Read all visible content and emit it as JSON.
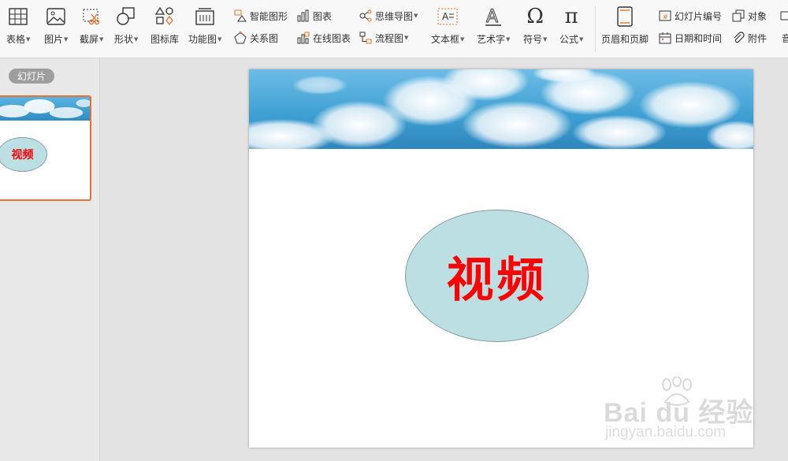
{
  "ribbon": {
    "table": "表格",
    "picture": "图片",
    "screenshot": "截屏",
    "shape": "形状",
    "icon_library": "图标库",
    "function_chart": "功能图",
    "smart_art": "智能图形",
    "relation": "关系图",
    "chart": "图表",
    "online_chart": "在线图表",
    "mind_map": "思维导图",
    "flow_chart": "流程图",
    "text_box": "文本框",
    "word_art": "艺术字",
    "symbol": "符号",
    "formula": "公式",
    "header_footer": "页眉和页脚",
    "slide_number": "幻灯片编号",
    "date_time": "日期和时间",
    "object": "对象",
    "attachment": "附件",
    "audio_cut": "音",
    "textbox_glyph": "A",
    "wordart_glyph": "A",
    "symbol_glyph": "Ω",
    "formula_glyph": "π"
  },
  "panel": {
    "tab": "幻灯片"
  },
  "slide": {
    "title": "视频"
  },
  "thumbnail": {
    "title": "视频"
  },
  "watermark": {
    "brand": "Bai du 经验",
    "url": "jingyan.baidu.com"
  },
  "colors": {
    "accent_orange": "#e8712c",
    "title_red": "#ff0000",
    "ellipse_fill": "#bcdfe3",
    "sky_blue": "#3d9ed1"
  }
}
